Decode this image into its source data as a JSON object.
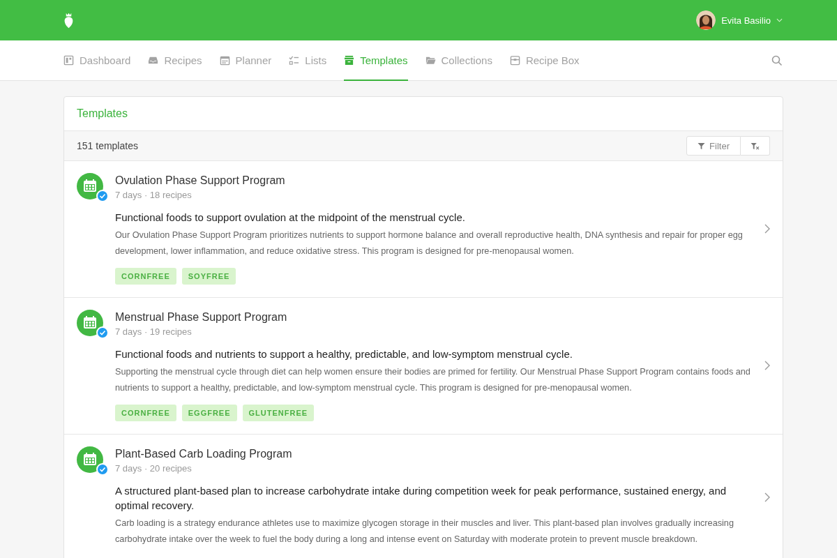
{
  "header": {
    "user_name": "Evita Basilio"
  },
  "nav": [
    {
      "label": "Dashboard",
      "selected": false
    },
    {
      "label": "Recipes",
      "selected": false
    },
    {
      "label": "Planner",
      "selected": false
    },
    {
      "label": "Lists",
      "selected": false
    },
    {
      "label": "Templates",
      "selected": true
    },
    {
      "label": "Collections",
      "selected": false
    },
    {
      "label": "Recipe Box",
      "selected": false
    }
  ],
  "panel": {
    "title": "Templates",
    "count": "151 templates",
    "filter_button": "Filter"
  },
  "templates": [
    {
      "title": "Ovulation Phase Support Program",
      "meta": "7 days · 18 recipes",
      "verified": true,
      "summary": "Functional foods to support ovulation at the midpoint of the menstrual cycle.",
      "description": "Our Ovulation Phase Support Program prioritizes nutrients to support hormone balance and overall reproductive health, DNA synthesis and repair for proper egg development, lower inflammation, and reduce oxidative stress. This program is designed for pre-menopausal women.",
      "tags": [
        "CORNFREE",
        "SOYFREE"
      ]
    },
    {
      "title": "Menstrual Phase Support Program",
      "meta": "7 days · 19 recipes",
      "verified": true,
      "summary": "Functional foods and nutrients to support a healthy, predictable, and low-symptom menstrual cycle.",
      "description": "Supporting the menstrual cycle through diet can help women ensure their bodies are primed for fertility. Our Menstrual Phase Support Program contains foods and nutrients to support a healthy, predictable, and low-symptom menstrual cycle. This program is designed for pre-menopausal women.",
      "tags": [
        "CORNFREE",
        "EGGFREE",
        "GLUTENFREE"
      ]
    },
    {
      "title": "Plant-Based Carb Loading Program",
      "meta": "7 days · 20 recipes",
      "verified": true,
      "summary": "A structured plant-based plan to increase carbohydrate intake during competition week for peak performance, sustained energy, and optimal recovery.",
      "description": "Carb loading is a strategy endurance athletes use to maximize glycogen storage in their muscles and liver. This plant-based plan involves gradually increasing carbohydrate intake over the week to fuel the body during a long and intense event on Saturday with moderate protein to prevent muscle breakdown."
    }
  ]
}
